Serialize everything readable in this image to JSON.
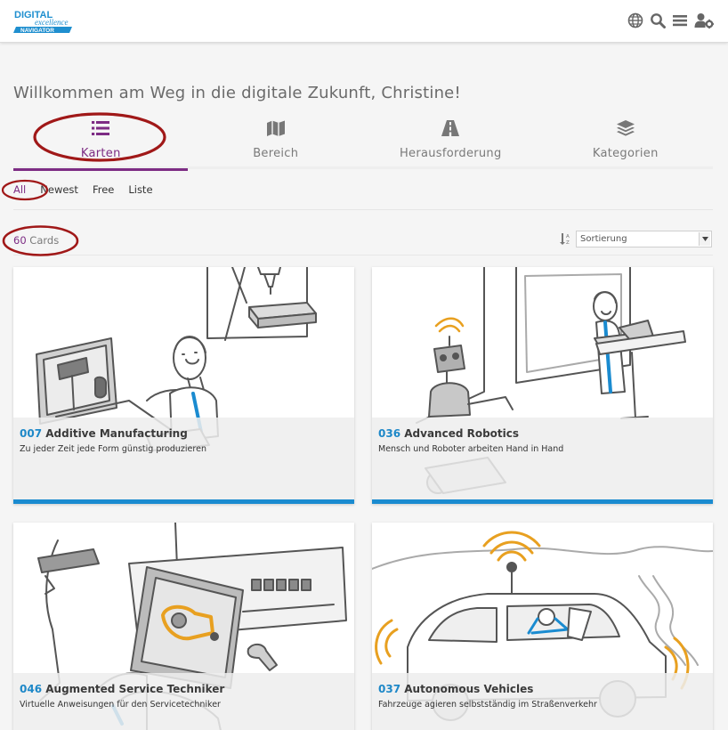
{
  "header": {
    "logo_text": "DIGITAL excellence NAVIGATOR",
    "icons": [
      "globe-icon",
      "search-icon",
      "menu-icon",
      "user-settings-icon"
    ]
  },
  "welcome": "Willkommen am Weg in die digitale Zukunft, Christine!",
  "tabs": [
    {
      "label": "Karten",
      "icon": "list-icon",
      "active": true
    },
    {
      "label": "Bereich",
      "icon": "map-icon",
      "active": false
    },
    {
      "label": "Herausforderung",
      "icon": "road-icon",
      "active": false
    },
    {
      "label": "Kategorien",
      "icon": "layers-icon",
      "active": false
    }
  ],
  "filters": [
    {
      "label": "All",
      "active": true
    },
    {
      "label": "Newest",
      "active": false
    },
    {
      "label": "Free",
      "active": false
    },
    {
      "label": "Liste",
      "active": false
    }
  ],
  "count": {
    "number": "60",
    "label": "Cards"
  },
  "sort": {
    "value": "Sortierung"
  },
  "cards": [
    {
      "code": "007",
      "title": "Additive Manufacturing",
      "subtitle": "Zu jeder Zeit jede Form günstig produzieren"
    },
    {
      "code": "036",
      "title": "Advanced Robotics",
      "subtitle": "Mensch und Roboter arbeiten Hand in Hand"
    },
    {
      "code": "046",
      "title": "Augmented Service Techniker",
      "subtitle": "Virtuelle Anweisungen für den Servicetechniker"
    },
    {
      "code": "037",
      "title": "Autonomous Vehicles",
      "subtitle": "Fahrzeuge agieren selbstständig im Straßenverkehr"
    }
  ],
  "colors": {
    "accent_purple": "#7d2c84",
    "card_accent_blue": "#1a8bd0",
    "code_blue": "#1e88c8",
    "annotation_red": "#a01818"
  }
}
